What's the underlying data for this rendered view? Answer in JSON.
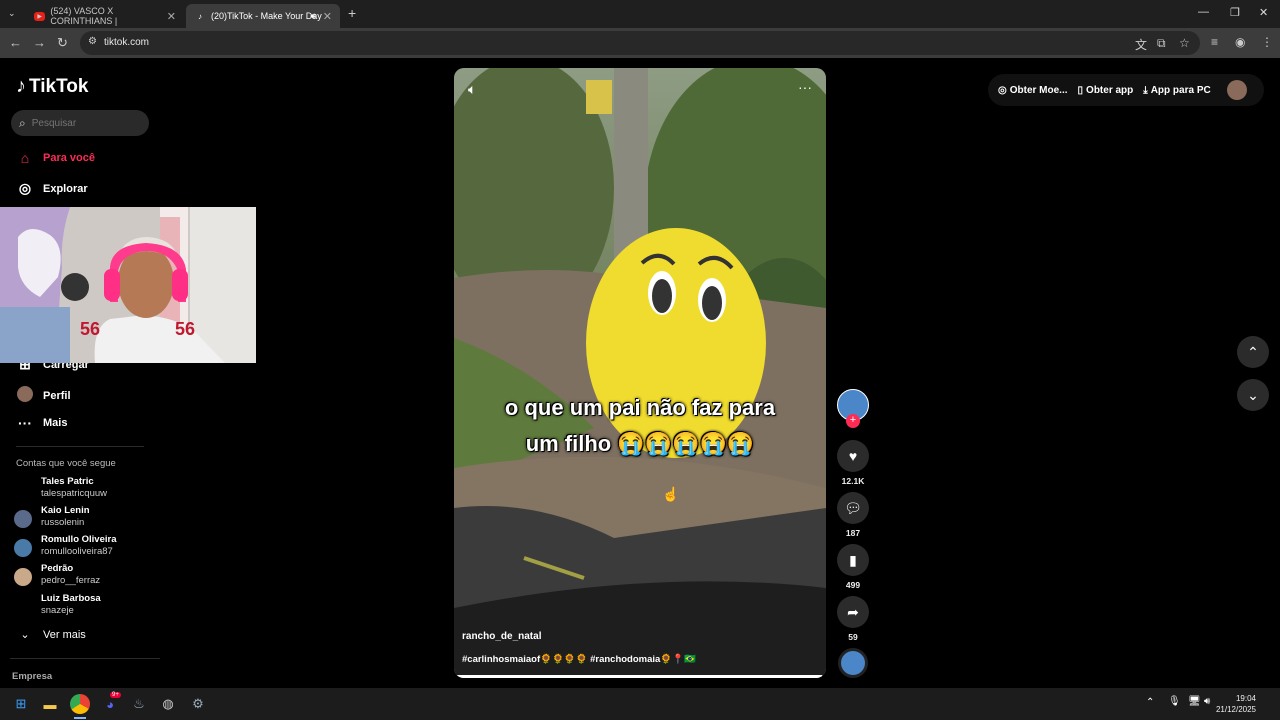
{
  "browser": {
    "tabs": [
      {
        "title": "(524) VASCO X CORINTHIANS |",
        "favicon": "youtube-icon"
      },
      {
        "title": "(20)TikTok - Make Your Day",
        "favicon": "tiktok-icon",
        "active": true
      }
    ],
    "url": "tiktok.com"
  },
  "sidebar": {
    "logo": "TikTok",
    "search_placeholder": "Pesquisar",
    "nav": [
      {
        "label": "Para você",
        "icon": "home-icon",
        "active": true
      },
      {
        "label": "Explorar",
        "icon": "compass-icon"
      },
      {
        "label": "Carregar",
        "icon": "upload-icon"
      },
      {
        "label": "Perfil",
        "icon": "avatar"
      },
      {
        "label": "Mais",
        "icon": "more-icon"
      }
    ],
    "following_title": "Contas que você segue",
    "following": [
      {
        "name": "Tales Patric",
        "handle": "talespatricquuw"
      },
      {
        "name": "Kaio Lenin",
        "handle": "russolenin"
      },
      {
        "name": "Romullo Oliveira",
        "handle": "romullooliveira87"
      },
      {
        "name": "Pedrão",
        "handle": "pedro__ferraz"
      },
      {
        "name": "Luiz Barbosa",
        "handle": "snazeje"
      }
    ],
    "see_more": "Ver mais",
    "footer": "Empresa"
  },
  "video": {
    "caption_line1": "o que um pai não  faz para",
    "caption_line2": "um filho 😭😭😭😭😭",
    "author": "rancho_de_natal",
    "tags": "#carlinhosmaiaof🌻🌻🌻🌻 #ranchodomaia🌻📍🇧🇷",
    "progress": 0.99
  },
  "actions": {
    "likes": "12.1K",
    "comments": "187",
    "saves": "499",
    "shares": "59"
  },
  "topbar": {
    "coins": "Obter Moe...",
    "get_app": "Obter app",
    "pc_app": "App para PC"
  },
  "taskbar": {
    "time": "19:04",
    "date": "21/12/2025",
    "discord_badge": "9+"
  },
  "colors": {
    "accent": "#fe2c55",
    "bg": "#000000"
  }
}
